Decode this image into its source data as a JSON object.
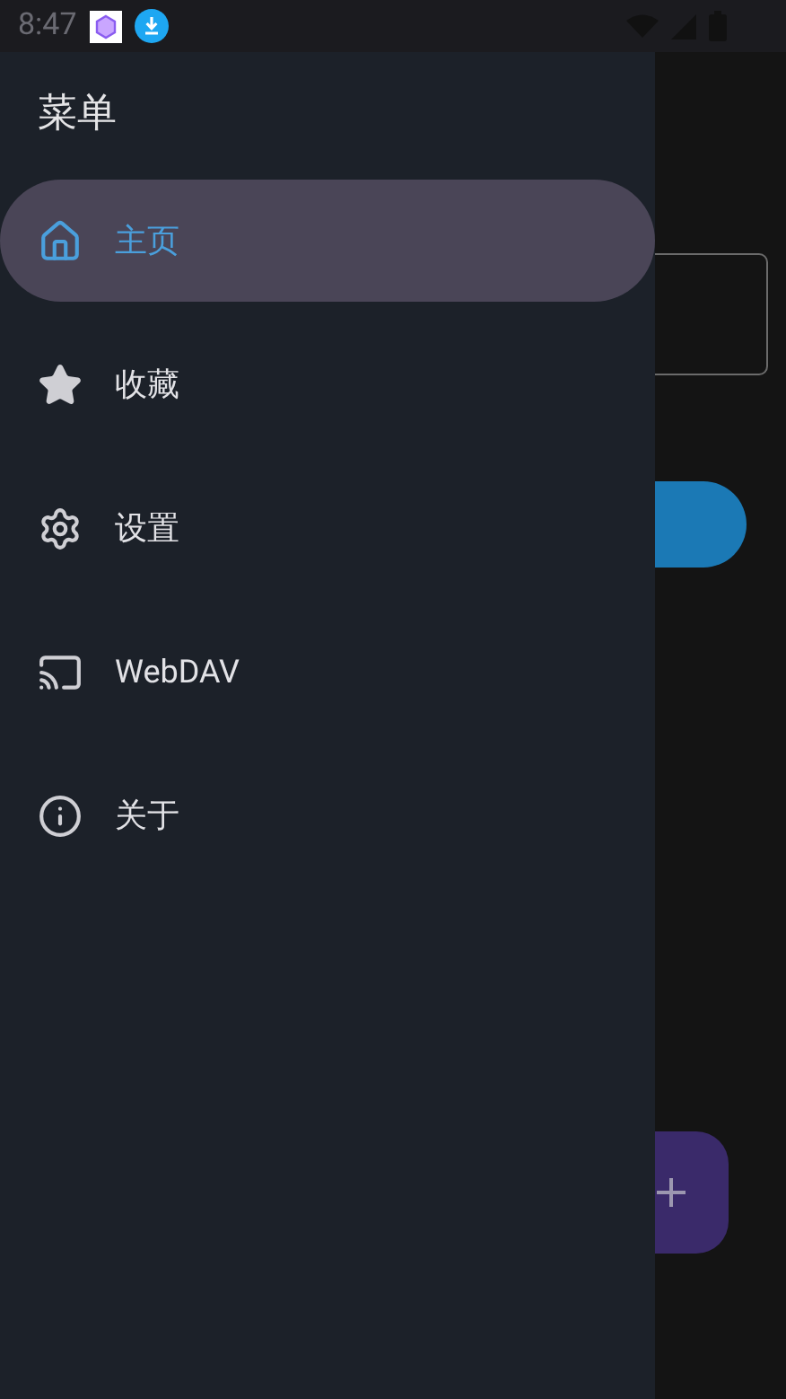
{
  "status_bar": {
    "time": "8:47"
  },
  "drawer": {
    "title": "菜单",
    "items": [
      {
        "label": "主页",
        "selected": true
      },
      {
        "label": "收藏",
        "selected": false
      },
      {
        "label": "设置",
        "selected": false
      },
      {
        "label": "WebDAV",
        "selected": false
      },
      {
        "label": "关于",
        "selected": false
      }
    ]
  }
}
